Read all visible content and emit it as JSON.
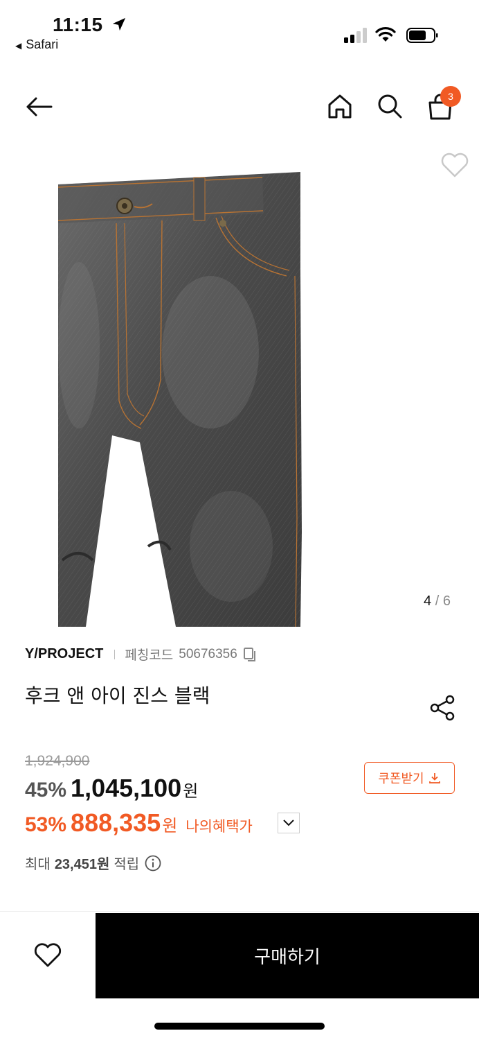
{
  "status_bar": {
    "time": "11:15",
    "back_app": "Safari"
  },
  "header": {
    "cart_count": "3"
  },
  "gallery": {
    "current": "4",
    "separator": "/",
    "total": "6"
  },
  "product": {
    "brand": "Y/PROJECT",
    "code_label": "페칭코드",
    "code": "50676356",
    "title": "후크 앤 아이 진스 블랙",
    "original_price": "1,924,900",
    "discount_rate": "45%",
    "price": "1,045,100",
    "currency": "원",
    "my_discount_rate": "53%",
    "my_price": "888,335",
    "my_currency": "원",
    "my_benefit_label": "나의혜택가",
    "coupon_label": "쿠폰받기",
    "points_prefix": "최대",
    "points_value": "23,451원",
    "points_suffix": "적립"
  },
  "footer": {
    "buy_label": "구매하기"
  },
  "colors": {
    "accent": "#f15a24",
    "buy_button": "#000000"
  },
  "icons": [
    "back-arrow-icon",
    "home-icon",
    "search-icon",
    "shopping-bag-icon",
    "heart-icon",
    "copy-icon",
    "share-icon",
    "download-icon",
    "chevron-down-icon",
    "info-icon",
    "location-arrow-icon",
    "signal-icon",
    "wifi-icon",
    "battery-icon"
  ]
}
